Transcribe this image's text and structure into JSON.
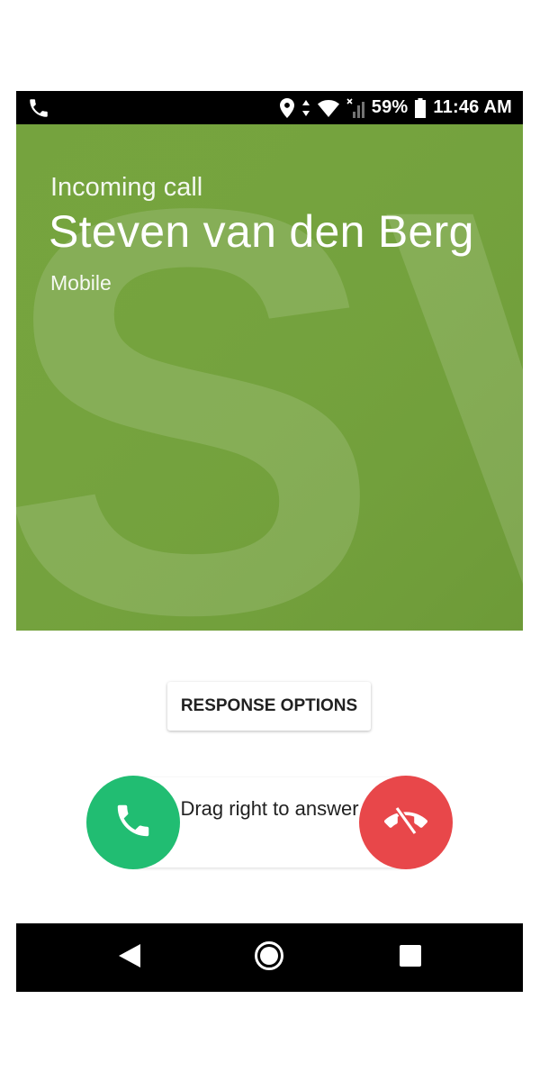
{
  "status_bar": {
    "battery": "59%",
    "time": "11:46 AM",
    "icons": [
      "phone-call-icon",
      "location-pin-icon",
      "data-arrows-icon",
      "wifi-icon",
      "no-signal-icon",
      "battery-icon"
    ]
  },
  "call": {
    "label": "Incoming call",
    "caller_name": "Steven van den Berg",
    "number_type": "Mobile",
    "monogram": "SV",
    "background_color": "#75a33e"
  },
  "response_options": {
    "label": "RESPONSE OPTIONS"
  },
  "slider": {
    "hint": "Drag right to answer",
    "answer_color": "#21bd72",
    "decline_color": "#e8474a"
  },
  "nav": {
    "icons": [
      "back-icon",
      "home-icon",
      "recents-icon"
    ]
  }
}
